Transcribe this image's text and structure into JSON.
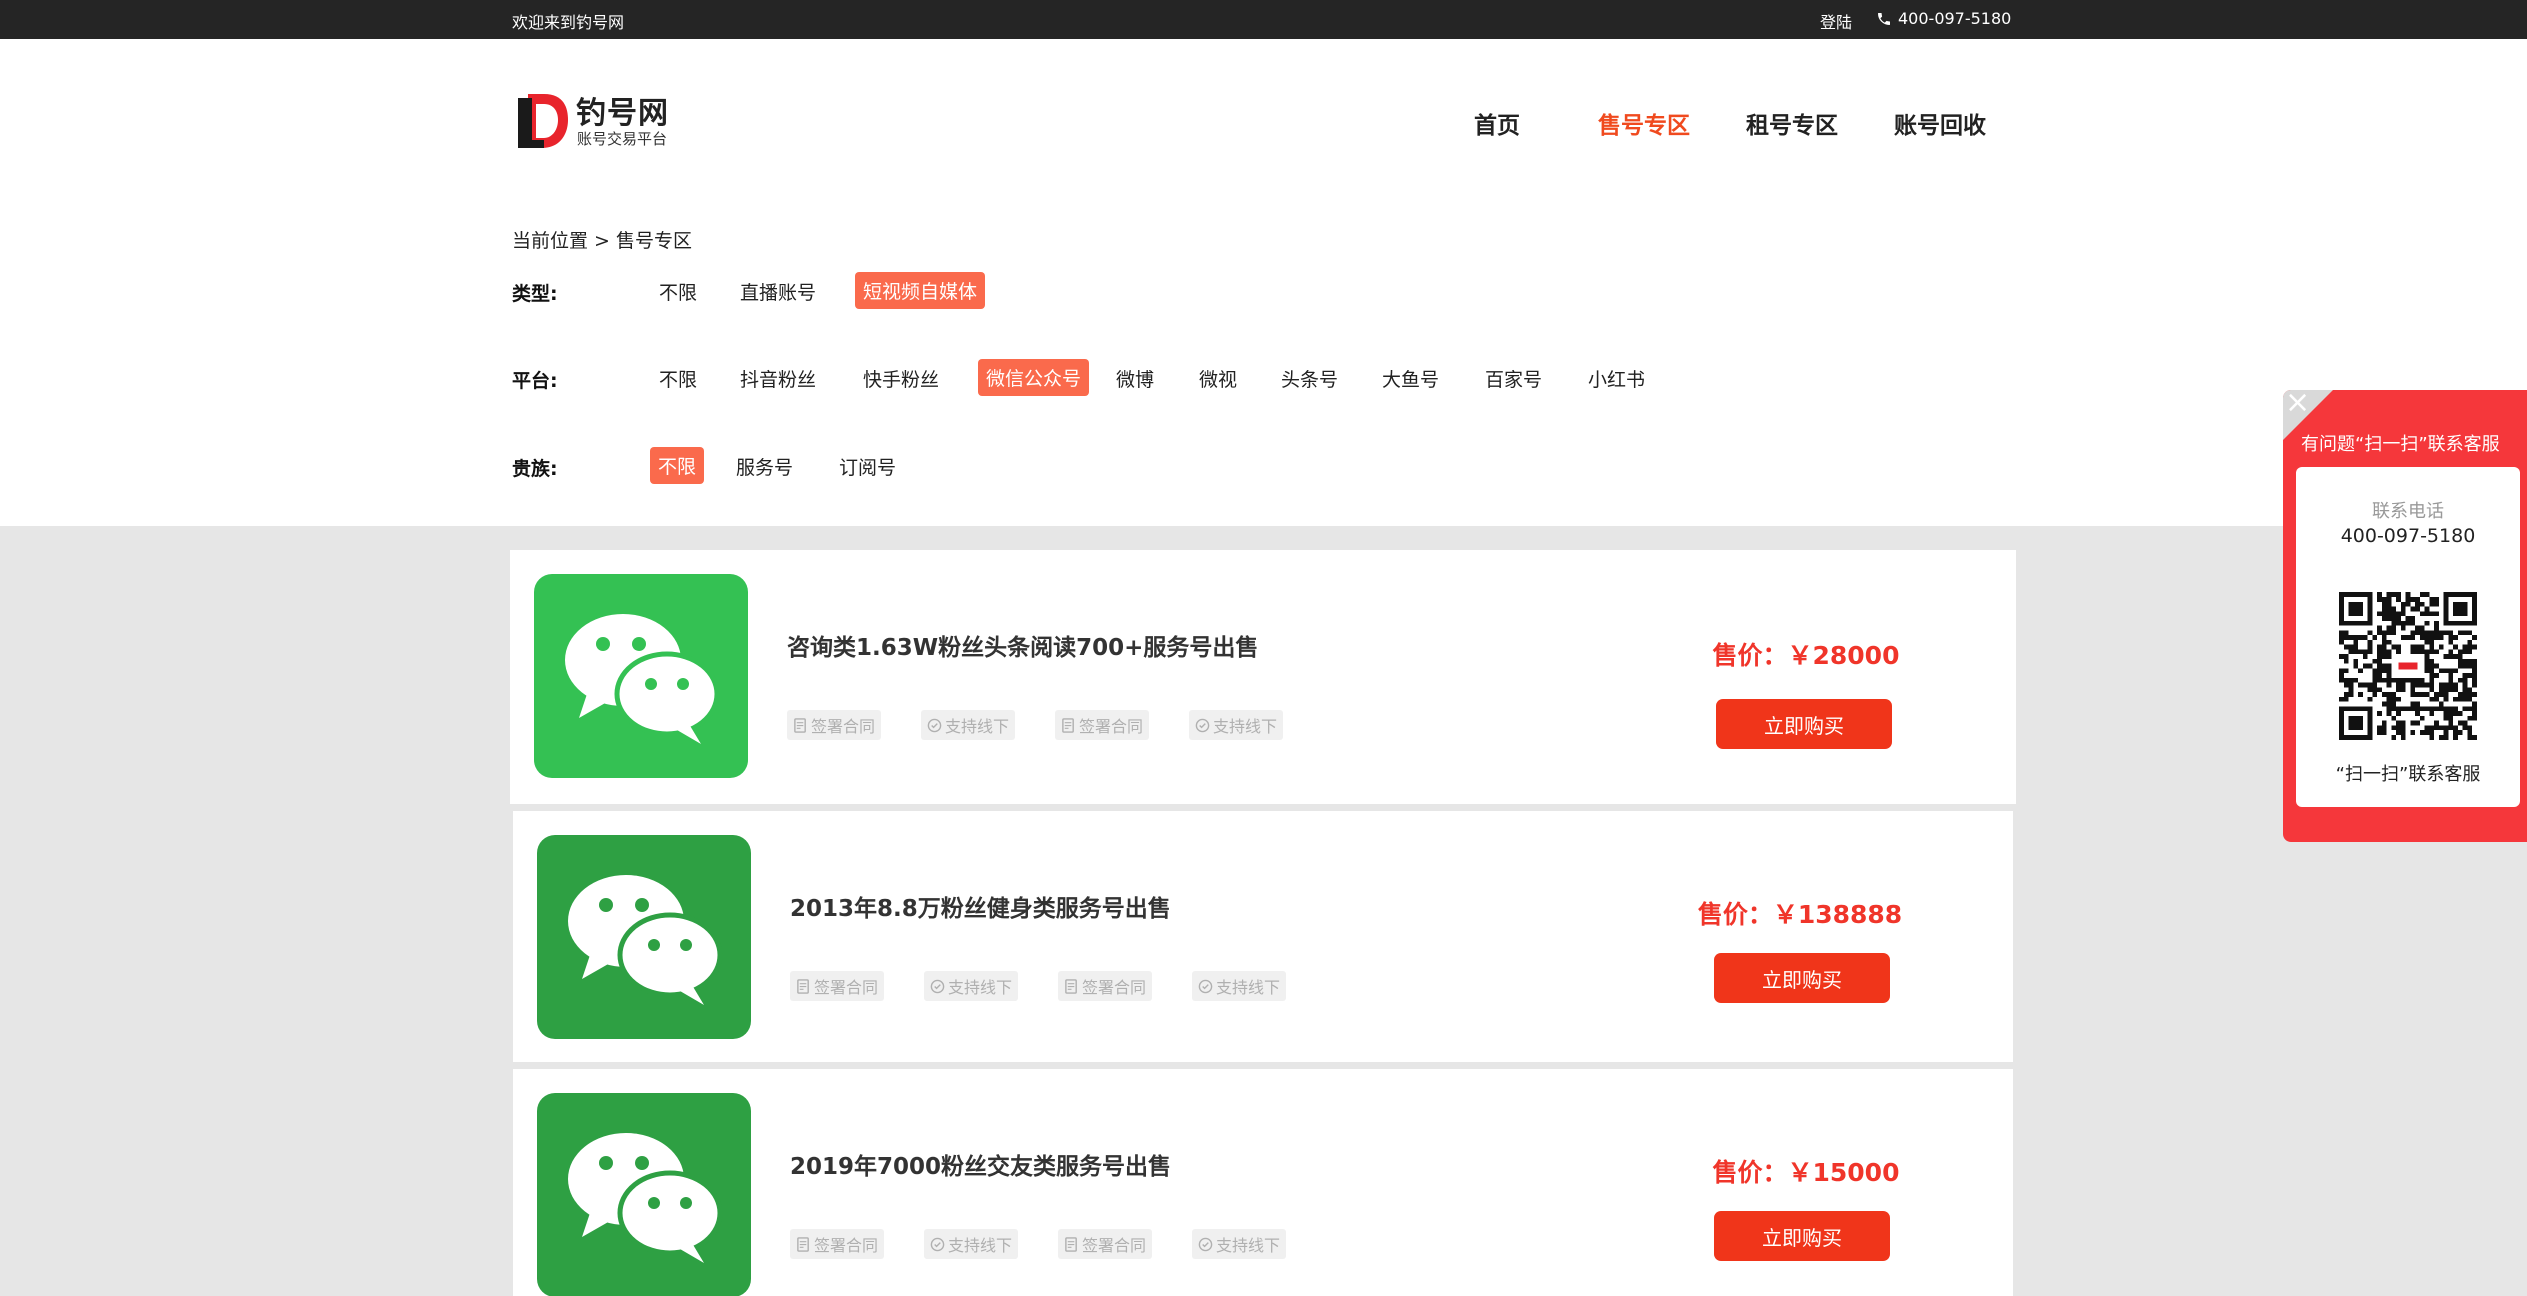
{
  "topbar": {
    "welcome": "欢迎来到钓号网",
    "login": "登陆",
    "phone": "400-097-5180"
  },
  "logo": {
    "name": "钓号网",
    "tagline": "账号交易平台"
  },
  "nav": [
    {
      "label": "首页"
    },
    {
      "label": "售号专区"
    },
    {
      "label": "租号专区"
    },
    {
      "label": "账号回收"
    }
  ],
  "breadcrumb": "当前位置 > 售号专区",
  "filters": {
    "type": {
      "label": "类型:",
      "options": [
        "不限",
        "直播账号",
        "短视频自媒体"
      ]
    },
    "platform": {
      "label": "平台:",
      "options": [
        "不限",
        "抖音粉丝",
        "快手粉丝",
        "微信公众号",
        "微博",
        "微视",
        "头条号",
        "大鱼号",
        "百家号",
        "小红书"
      ]
    },
    "noble": {
      "label": "贵族:",
      "options": [
        "不限",
        "服务号",
        "订阅号"
      ]
    }
  },
  "products": [
    {
      "title": "咨询类1.63W粉丝头条阅读700+服务号出售",
      "price": "售价：￥28000",
      "buy": "立即购买",
      "tags": [
        "签署合同",
        "支持线下",
        "签署合同",
        "支持线下"
      ]
    },
    {
      "title": "2013年8.8万粉丝健身类服务号出售",
      "price": "售价：￥138888",
      "buy": "立即购买",
      "tags": [
        "签署合同",
        "支持线下",
        "签署合同",
        "支持线下"
      ]
    },
    {
      "title": "2019年7000粉丝交友类服务号出售",
      "price": "售价：￥15000",
      "buy": "立即购买",
      "tags": [
        "签署合同",
        "支持线下",
        "签署合同",
        "支持线下"
      ]
    }
  ],
  "side_panel": {
    "close": "×",
    "head": "有问题“扫一扫”联系客服",
    "phone_label": "联系电话",
    "phone": "400-097-5180",
    "qr_caption": "“扫一扫”联系客服"
  },
  "colors": {
    "accent": "#f04a1e",
    "price": "#f0352a",
    "button": "#f0351a",
    "tag_selected": "#fa6a4c",
    "wechat_light": "#34c153",
    "wechat_dark": "#2ea043",
    "side_panel": "#f5373b"
  }
}
